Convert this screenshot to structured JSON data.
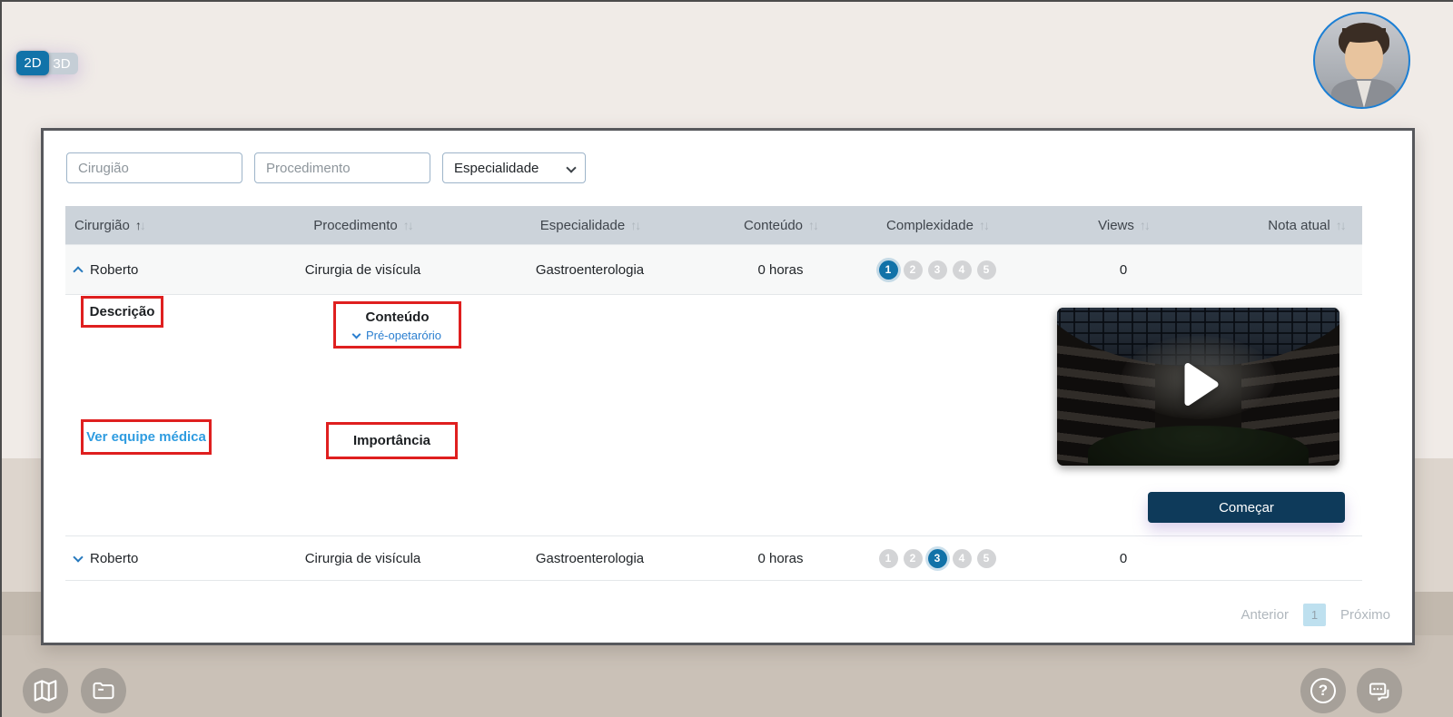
{
  "view_toggle": {
    "options": [
      {
        "label": "2D",
        "active": true
      },
      {
        "label": "3D",
        "active": false
      }
    ]
  },
  "filters": {
    "surgeon": {
      "placeholder": "Cirugião",
      "value": ""
    },
    "procedure": {
      "placeholder": "Procedimento",
      "value": ""
    },
    "specialty": {
      "selected": "Especialidade"
    }
  },
  "table": {
    "headers": [
      {
        "label": "Cirurgião",
        "sort": "asc"
      },
      {
        "label": "Procedimento",
        "sort": "none"
      },
      {
        "label": "Especialidade",
        "sort": "none"
      },
      {
        "label": "Conteúdo",
        "sort": "none"
      },
      {
        "label": "Complexidade",
        "sort": "none"
      },
      {
        "label": "Views",
        "sort": "none"
      },
      {
        "label": "Nota atual",
        "sort": "none"
      }
    ],
    "complexity_scale": [
      "1",
      "2",
      "3",
      "4",
      "5"
    ],
    "rows": [
      {
        "expanded": true,
        "surgeon": "Roberto",
        "procedure": "Cirurgia de visícula",
        "specialty": "Gastroenterologia",
        "content": "0 horas",
        "complexity": 1,
        "views": "0",
        "grade": ""
      },
      {
        "expanded": false,
        "surgeon": "Roberto",
        "procedure": "Cirurgia de visícula",
        "specialty": "Gastroenterologia",
        "content": "0 horas",
        "complexity": 3,
        "views": "0",
        "grade": ""
      }
    ]
  },
  "detail": {
    "description_label": "Descrição",
    "content_label": "Conteúdo",
    "content_item": "Pré-opetarório",
    "team_link": "Ver equipe médica",
    "importance_label": "Importância",
    "start_button": "Começar"
  },
  "pagination": {
    "previous": "Anterior",
    "page": "1",
    "next": "Próximo"
  },
  "icons": {
    "sort_up": "↑",
    "sort_down": "↓",
    "help_glyph": "?"
  },
  "colors": {
    "accent_blue": "#1172a8",
    "link_blue": "#2f9ce0",
    "content_link_blue": "#2b7fd0",
    "highlight_red": "#df1f1f",
    "start_button_navy": "#0e3a5a",
    "table_header_bg": "#ccd3da",
    "page_number_bg": "#bee0ef"
  }
}
